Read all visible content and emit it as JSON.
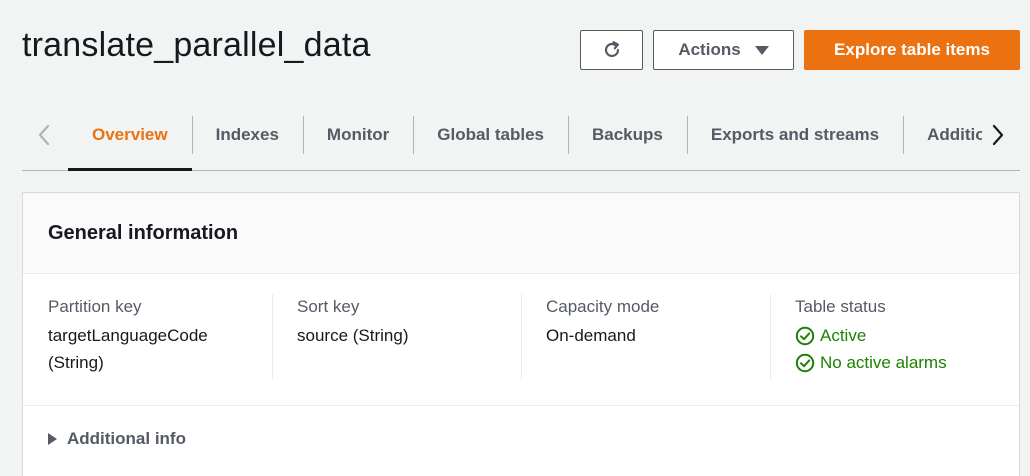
{
  "page": {
    "title": "translate_parallel_data"
  },
  "header_actions": {
    "refresh_icon": "refresh-icon",
    "actions_label": "Actions",
    "explore_label": "Explore table items"
  },
  "tabs": {
    "items": [
      {
        "label": "Overview",
        "active": true
      },
      {
        "label": "Indexes"
      },
      {
        "label": "Monitor"
      },
      {
        "label": "Global tables"
      },
      {
        "label": "Backups"
      },
      {
        "label": "Exports and streams"
      },
      {
        "label": "Additional settings"
      }
    ]
  },
  "general_info": {
    "title": "General information",
    "partition_key": {
      "label": "Partition key",
      "value_line1": "targetLanguageCode",
      "value_line2": "(String)"
    },
    "sort_key": {
      "label": "Sort key",
      "value": "source (String)"
    },
    "capacity_mode": {
      "label": "Capacity mode",
      "value": "On-demand"
    },
    "table_status": {
      "label": "Table status",
      "status": "Active",
      "alarms": "No active alarms"
    },
    "additional_info": "Additional info"
  },
  "colors": {
    "accent": "#ec7211",
    "success": "#1d8102",
    "text": "#16191f",
    "muted": "#545b64"
  }
}
